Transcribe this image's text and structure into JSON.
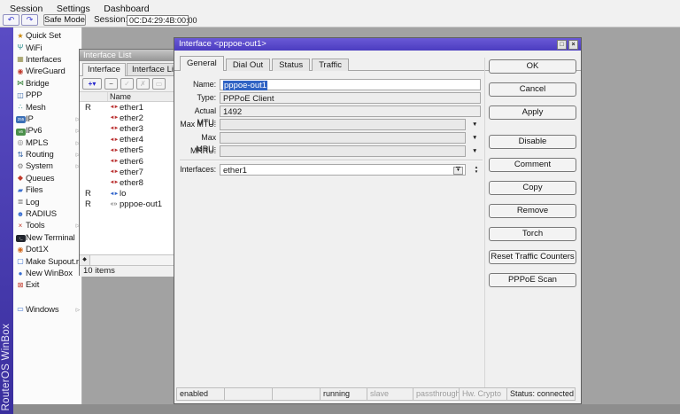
{
  "menu": {
    "items": [
      "Session",
      "Settings",
      "Dashboard"
    ]
  },
  "toolbar": {
    "undo_icon": "↶",
    "redo_icon": "↷",
    "safe_mode_label": "Safe Mode",
    "session_label": "Session:",
    "session_value": "0C:D4:29:4B:00:00"
  },
  "brand": {
    "vertical_text": "RouterOS WinBox"
  },
  "sidebar": {
    "items": [
      {
        "label": "Quick Set",
        "glyph": "★"
      },
      {
        "label": "WiFi",
        "glyph": "Ψ"
      },
      {
        "label": "Interfaces",
        "glyph": "▦"
      },
      {
        "label": "WireGuard",
        "glyph": "◉"
      },
      {
        "label": "Bridge",
        "glyph": "⋈"
      },
      {
        "label": "PPP",
        "glyph": "◫"
      },
      {
        "label": "Mesh",
        "glyph": "∴"
      },
      {
        "label": "IP",
        "glyph": "255",
        "arrow": "▷"
      },
      {
        "label": "IPv6",
        "glyph": "v6",
        "arrow": "▷"
      },
      {
        "label": "MPLS",
        "glyph": "◎",
        "arrow": "▷"
      },
      {
        "label": "Routing",
        "glyph": "⇅",
        "arrow": "▷"
      },
      {
        "label": "System",
        "glyph": "⚙",
        "arrow": "▷"
      },
      {
        "label": "Queues",
        "glyph": "◆"
      },
      {
        "label": "Files",
        "glyph": "▰"
      },
      {
        "label": "Log",
        "glyph": "≣"
      },
      {
        "label": "RADIUS",
        "glyph": "☻"
      },
      {
        "label": "Tools",
        "glyph": "×",
        "arrow": "▷"
      },
      {
        "label": "New Terminal",
        "glyph": "›_"
      },
      {
        "label": "Dot1X",
        "glyph": "◉"
      },
      {
        "label": "Make Supout.rif",
        "glyph": "▢"
      },
      {
        "label": "New WinBox",
        "glyph": "●"
      },
      {
        "label": "Exit",
        "glyph": "⊠"
      },
      {
        "label": "Windows",
        "glyph": "▭",
        "arrow": "▷"
      }
    ]
  },
  "iflist": {
    "title": "Interface List",
    "tabs": [
      "Interface",
      "Interface List"
    ],
    "tools": {
      "add": "+",
      "add_caret": "▾",
      "remove": "−",
      "enable": "✓",
      "disable": "✗",
      "comment": "▭"
    },
    "header": {
      "name": "Name",
      "sort": "/"
    },
    "rows": [
      {
        "flag": "R",
        "glyph": "◄►",
        "name": "ether1"
      },
      {
        "flag": "",
        "glyph": "◄►",
        "name": "ether2"
      },
      {
        "flag": "",
        "glyph": "◄►",
        "name": "ether3"
      },
      {
        "flag": "",
        "glyph": "◄►",
        "name": "ether4"
      },
      {
        "flag": "",
        "glyph": "◄►",
        "name": "ether5"
      },
      {
        "flag": "",
        "glyph": "◄►",
        "name": "ether6"
      },
      {
        "flag": "",
        "glyph": "◄►",
        "name": "ether7"
      },
      {
        "flag": "",
        "glyph": "◄►",
        "name": "ether8"
      },
      {
        "flag": "R",
        "glyph": "◄►",
        "name": "lo"
      },
      {
        "flag": "R",
        "glyph": "«»",
        "name": "pppoe-out1"
      }
    ],
    "scroll_left_glyph": "◆",
    "footer": "10 items"
  },
  "dialog": {
    "title": "Interface <pppoe-out1>",
    "win_buttons": {
      "maximize": "□",
      "close": "×"
    },
    "tabs": [
      "General",
      "Dial Out",
      "Status",
      "Traffic"
    ],
    "fields": {
      "name_label": "Name:",
      "name_value": "pppoe-out1",
      "type_label": "Type:",
      "type_value": "PPPoE Client",
      "actual_mtu_label": "Actual MTU:",
      "actual_mtu_value": "1492",
      "max_mtu_label": "Max MTU:",
      "max_mtu_value": "",
      "max_mru_label": "Max MRU:",
      "max_mru_value": "",
      "mrru_label": "MRRU:",
      "mrru_value": "",
      "interfaces_label": "Interfaces:",
      "interfaces_value": "ether1"
    },
    "icons": {
      "combo_arrow": "▼",
      "dropdown": "▼",
      "spin_up": "▲",
      "spin_down": "▼"
    },
    "buttons": [
      "OK",
      "Cancel",
      "Apply",
      "Disable",
      "Comment",
      "Copy",
      "Remove",
      "Torch",
      "Reset Traffic Counters",
      "PPPoE Scan"
    ],
    "status_segments": [
      {
        "label": "enabled"
      },
      {
        "label": ""
      },
      {
        "label": ""
      },
      {
        "label": "running"
      },
      {
        "label": "slave"
      },
      {
        "label": "passthrough"
      },
      {
        "label": "Hw. Crypto"
      },
      {
        "label": "Status: connected"
      }
    ]
  },
  "colors": {
    "title_active": "#4b3cc0",
    "accent_strip": "#4a3fa8",
    "selection": "#2f63c4",
    "workspace": "#a2a2a2"
  }
}
